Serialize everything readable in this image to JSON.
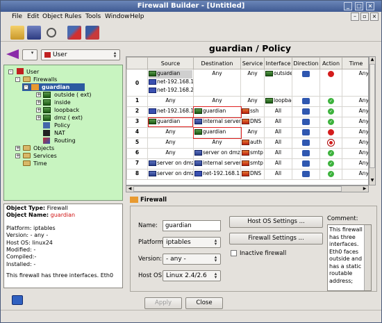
{
  "window": {
    "title": "Firewall Builder - [Untitled]"
  },
  "menu": [
    "File",
    "Edit",
    "Object",
    "Rules",
    "Tools",
    "Window",
    "Help"
  ],
  "library": {
    "selected": "User"
  },
  "tree": {
    "root": "User",
    "firewalls": "Firewalls",
    "guardian": "guardian",
    "ifaces": [
      "outside ( ext)",
      "inside",
      "loopback",
      "dmz ( ext)"
    ],
    "policy": "Policy",
    "nat": "NAT",
    "routing": "Routing",
    "objects": "Objects",
    "services": "Services",
    "time": "Time"
  },
  "info": {
    "type_label": "Object Type:",
    "type_val": "Firewall",
    "name_label": "Object Name:",
    "name_val": "guardian",
    "platform": "Platform:  iptables",
    "version": "Version:  - any -",
    "hostos": "Host OS:  linux24",
    "modified": "Modified: -",
    "compiled": "Compiled:-",
    "installed": "Installed: -",
    "tail": "This firewall has three interfaces. Eth0"
  },
  "policy": {
    "title": "guardian / Policy",
    "headers": [
      "",
      "Source",
      "Destination",
      "Service",
      "Interface",
      "Direction",
      "Action",
      "Time"
    ],
    "rows": [
      {
        "n": "0",
        "src": [
          "guardian",
          "net-192.168.1.0",
          "net-192.168.2.0"
        ],
        "dst": "Any",
        "svc": "Any",
        "iface": "outside",
        "act": "deny",
        "time": "Any"
      },
      {
        "n": "1",
        "src": [
          "Any"
        ],
        "dst": "Any",
        "svc": "Any",
        "iface": "loopback",
        "act": "accept",
        "time": "Any"
      },
      {
        "n": "2",
        "src": [
          "net-192.168.1.0"
        ],
        "dst": "guardian",
        "svc": "ssh",
        "iface": "All",
        "act": "accept",
        "time": "Any"
      },
      {
        "n": "3",
        "src": [
          "guardian"
        ],
        "dst": "internal server",
        "svc": "DNS",
        "iface": "All",
        "act": "accept",
        "time": "Any"
      },
      {
        "n": "4",
        "src": [
          "Any"
        ],
        "dst": "guardian",
        "svc": "Any",
        "iface": "All",
        "act": "deny",
        "time": "Any"
      },
      {
        "n": "5",
        "src": [
          "Any"
        ],
        "dst": "Any",
        "svc": "auth",
        "iface": "All",
        "act": "reject",
        "time": "Any"
      },
      {
        "n": "6",
        "src": [
          "Any"
        ],
        "dst": "server on dmz",
        "svc": "smtp",
        "iface": "All",
        "act": "accept",
        "time": "Any"
      },
      {
        "n": "7",
        "src": [
          "server on dmz"
        ],
        "dst": "internal server",
        "svc": "smtp",
        "iface": "All",
        "act": "accept",
        "time": "Any"
      },
      {
        "n": "8",
        "src": [
          "server on dmz"
        ],
        "dst": "net-192.168.1.0",
        "svc": "DNS",
        "iface": "All",
        "act": "accept",
        "time": "Any"
      }
    ]
  },
  "editor": {
    "header": "Firewall",
    "name_label": "Name:",
    "name_val": "guardian",
    "platform_label": "Platform:",
    "platform_val": "iptables",
    "version_label": "Version:",
    "version_val": "- any -",
    "hostos_label": "Host OS:",
    "hostos_val": "Linux 2.4/2.6",
    "hostos_btn": "Host OS Settings ...",
    "fw_btn": "Firewall Settings ...",
    "inactive": "Inactive firewall",
    "comment_label": "Comment:",
    "comment": "This firewall has three interfaces. Eth0 faces outside and has a static routable address;"
  },
  "buttons": {
    "apply": "Apply",
    "close": "Close"
  }
}
